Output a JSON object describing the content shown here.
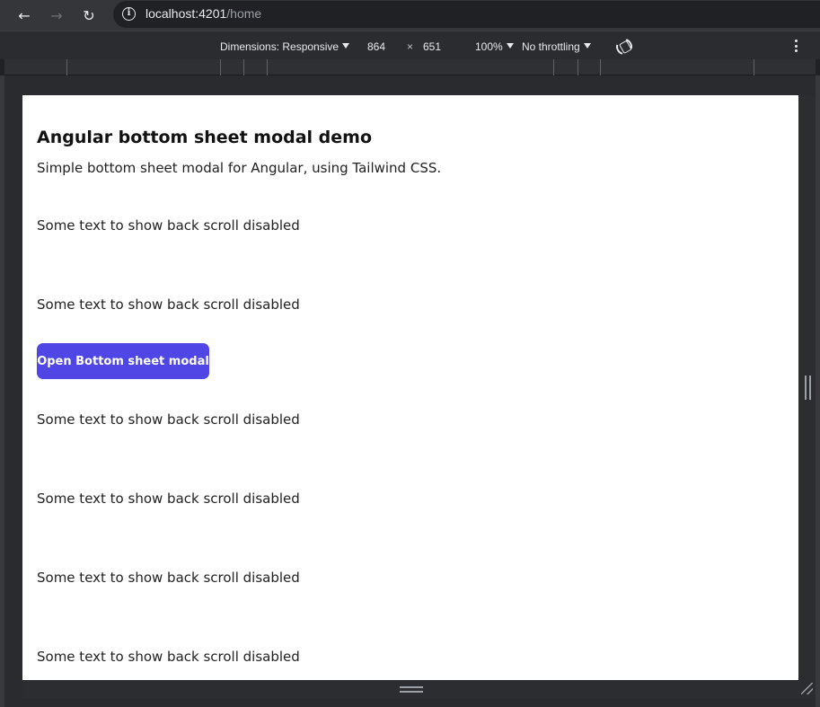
{
  "browser": {
    "url_host": "localhost:4201",
    "url_path": "/home",
    "icons": [
      "back-arrow-icon",
      "forward-arrow-icon",
      "reload-icon",
      "site-info-icon"
    ]
  },
  "device_toolbar": {
    "dimensions_label": "Dimensions: Responsive",
    "width": "864",
    "times": "×",
    "height": "651",
    "zoom": "100%",
    "throttling": "No throttling",
    "icons": [
      "rotate-icon",
      "more-options-icon"
    ]
  },
  "page": {
    "title": "Angular bottom sheet modal demo",
    "subtitle": "Simple bottom sheet modal for Angular, using Tailwind CSS.",
    "filler_text": "Some text to show back scroll disabled",
    "button_label": "Open Bottom sheet modal",
    "button_color": "#4f46e5"
  }
}
